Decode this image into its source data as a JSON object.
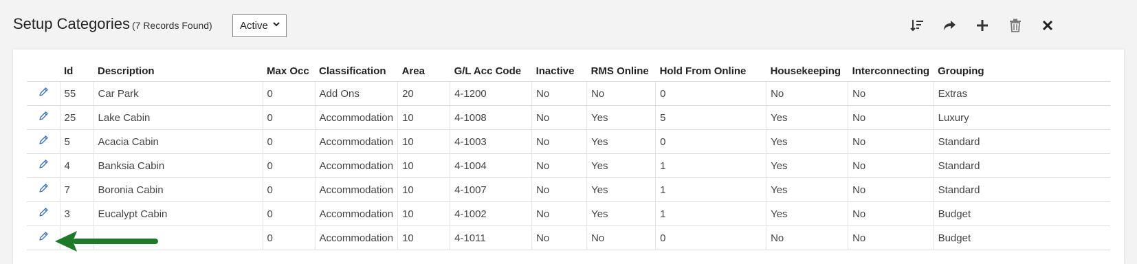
{
  "header": {
    "title": "Setup Categories",
    "record_count": "(7 Records Found)",
    "status_filter": "Active"
  },
  "toolbar": {
    "icons": [
      "sort-icon",
      "export-icon",
      "add-icon",
      "delete-icon",
      "close-icon"
    ]
  },
  "table": {
    "columns": [
      "Id",
      "Description",
      "Max Occ",
      "Classification",
      "Area",
      "G/L Acc Code",
      "Inactive",
      "RMS Online",
      "Hold From Online",
      "Housekeeping",
      "Interconnecting",
      "Grouping"
    ],
    "rows": [
      {
        "id": "55",
        "description": "Car Park",
        "max_occ": "0",
        "classification": "Add Ons",
        "area": "20",
        "gl": "4-1200",
        "inactive": "No",
        "rms_online": "No",
        "hold": "0",
        "housekeeping": "No",
        "interconnecting": "No",
        "grouping": "Extras"
      },
      {
        "id": "25",
        "description": "Lake Cabin",
        "max_occ": "0",
        "classification": "Accommodation",
        "area": "10",
        "gl": "4-1008",
        "inactive": "No",
        "rms_online": "Yes",
        "hold": "5",
        "housekeeping": "Yes",
        "interconnecting": "No",
        "grouping": "Luxury"
      },
      {
        "id": "5",
        "description": "Acacia Cabin",
        "max_occ": "0",
        "classification": "Accommodation",
        "area": "10",
        "gl": "4-1003",
        "inactive": "No",
        "rms_online": "Yes",
        "hold": "0",
        "housekeeping": "Yes",
        "interconnecting": "No",
        "grouping": "Standard"
      },
      {
        "id": "4",
        "description": "Banksia Cabin",
        "max_occ": "0",
        "classification": "Accommodation",
        "area": "10",
        "gl": "4-1004",
        "inactive": "No",
        "rms_online": "Yes",
        "hold": "1",
        "housekeeping": "Yes",
        "interconnecting": "No",
        "grouping": "Standard"
      },
      {
        "id": "7",
        "description": "Boronia Cabin",
        "max_occ": "0",
        "classification": "Accommodation",
        "area": "10",
        "gl": "4-1007",
        "inactive": "No",
        "rms_online": "Yes",
        "hold": "1",
        "housekeeping": "Yes",
        "interconnecting": "No",
        "grouping": "Standard"
      },
      {
        "id": "3",
        "description": "Eucalypt Cabin",
        "max_occ": "0",
        "classification": "Accommodation",
        "area": "10",
        "gl": "4-1002",
        "inactive": "No",
        "rms_online": "Yes",
        "hold": "1",
        "housekeeping": "Yes",
        "interconnecting": "No",
        "grouping": "Budget"
      },
      {
        "id": "",
        "description": "",
        "max_occ": "0",
        "classification": "Accommodation",
        "area": "10",
        "gl": "4-1011",
        "inactive": "No",
        "rms_online": "No",
        "hold": "0",
        "housekeeping": "No",
        "interconnecting": "No",
        "grouping": "Budget"
      }
    ]
  },
  "colors": {
    "accent_blue": "#3b6fb6",
    "arrow_green": "#1e7a2a"
  }
}
